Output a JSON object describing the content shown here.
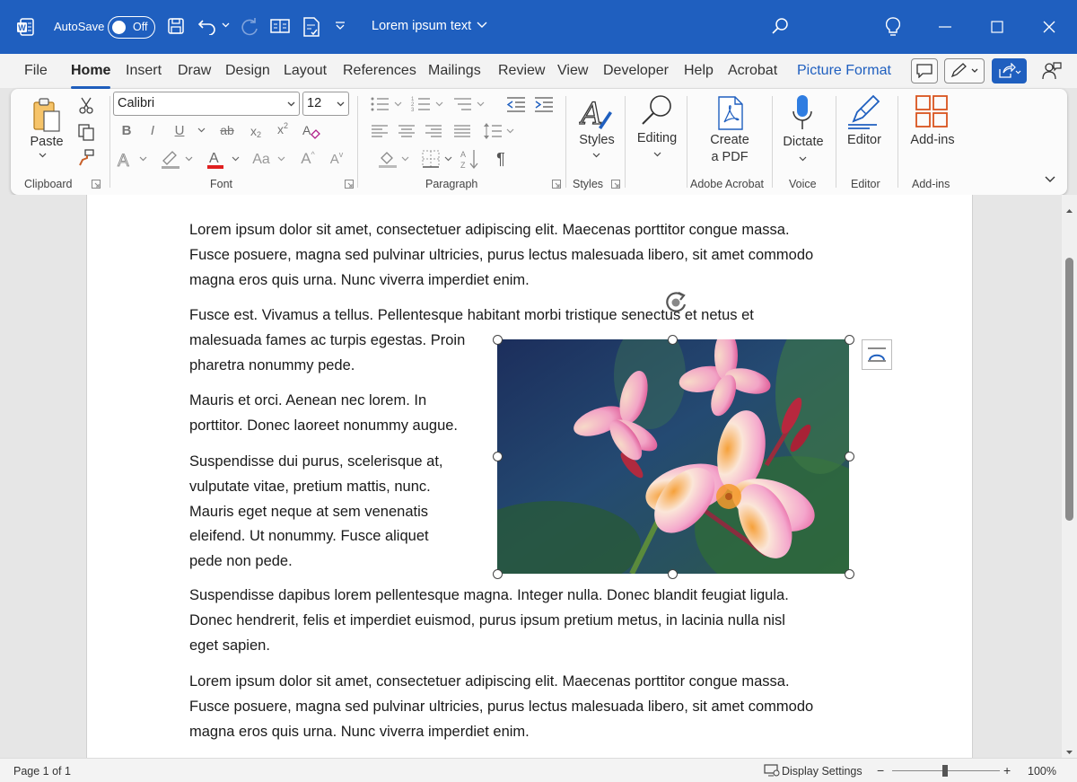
{
  "titlebar": {
    "autosave_label": "AutoSave",
    "autosave_state": "Off",
    "document_title": "Lorem ipsum text",
    "accent_color": "#1f5fbf"
  },
  "tabs": [
    "File",
    "Home",
    "Insert",
    "Draw",
    "Design",
    "Layout",
    "References",
    "Mailings",
    "Review",
    "View",
    "Developer",
    "Help",
    "Acrobat",
    "Picture Format"
  ],
  "active_tab": "Home",
  "ribbon": {
    "clipboard": {
      "paste_label": "Paste",
      "group_label": "Clipboard"
    },
    "font": {
      "font_name": "Calibri",
      "font_size": "12",
      "group_label": "Font"
    },
    "paragraph": {
      "group_label": "Paragraph"
    },
    "styles": {
      "button_label": "Styles",
      "group_label": "Styles"
    },
    "editing": {
      "button_label": "Editing"
    },
    "adobe": {
      "line1": "Create",
      "line2": "a PDF",
      "group_label": "Adobe Acrobat"
    },
    "voice": {
      "button_label": "Dictate",
      "group_label": "Voice"
    },
    "editor": {
      "button_label": "Editor",
      "group_label": "Editor"
    },
    "addins": {
      "button_label": "Add-ins",
      "group_label": "Add-ins"
    }
  },
  "document": {
    "p1": [
      "Lorem ipsum dolor sit amet, consectetuer adipiscing elit. Maecenas porttitor congue massa.",
      "Fusce posuere, magna sed pulvinar ultricies, purus lectus malesuada libero, sit amet commodo",
      "magna eros quis urna. Nunc viverra imperdiet enim."
    ],
    "p2": [
      "Fusce est. Vivamus a tellus. Pellentesque habitant morbi tristique senectus et netus et",
      "malesuada fames ac turpis egestas. Proin",
      "pharetra nonummy pede."
    ],
    "p3": [
      "Mauris et orci. Aenean nec lorem. In",
      "porttitor. Donec laoreet nonummy augue."
    ],
    "p4": [
      "Suspendisse dui purus, scelerisque at,",
      "vulputate vitae, pretium mattis, nunc.",
      "Mauris eget neque at sem venenatis",
      "eleifend. Ut nonummy. Fusce aliquet",
      "pede non pede."
    ],
    "p5": [
      "Suspendisse dapibus lorem pellentesque magna. Integer nulla. Donec blandit feugiat ligula.",
      "Donec hendrerit, felis et imperdiet euismod, purus ipsum pretium metus, in lacinia nulla nisl",
      "eget sapien."
    ],
    "p6": [
      "Lorem ipsum dolor sit amet, consectetuer adipiscing elit. Maecenas porttitor congue massa.",
      "Fusce posuere, magna sed pulvinar ultricies, purus lectus malesuada libero, sit amet commodo",
      "magna eros quis urna. Nunc viverra imperdiet enim."
    ]
  },
  "statusbar": {
    "page_info": "Page 1 of 1",
    "display_settings": "Display Settings",
    "zoom": "100%"
  }
}
